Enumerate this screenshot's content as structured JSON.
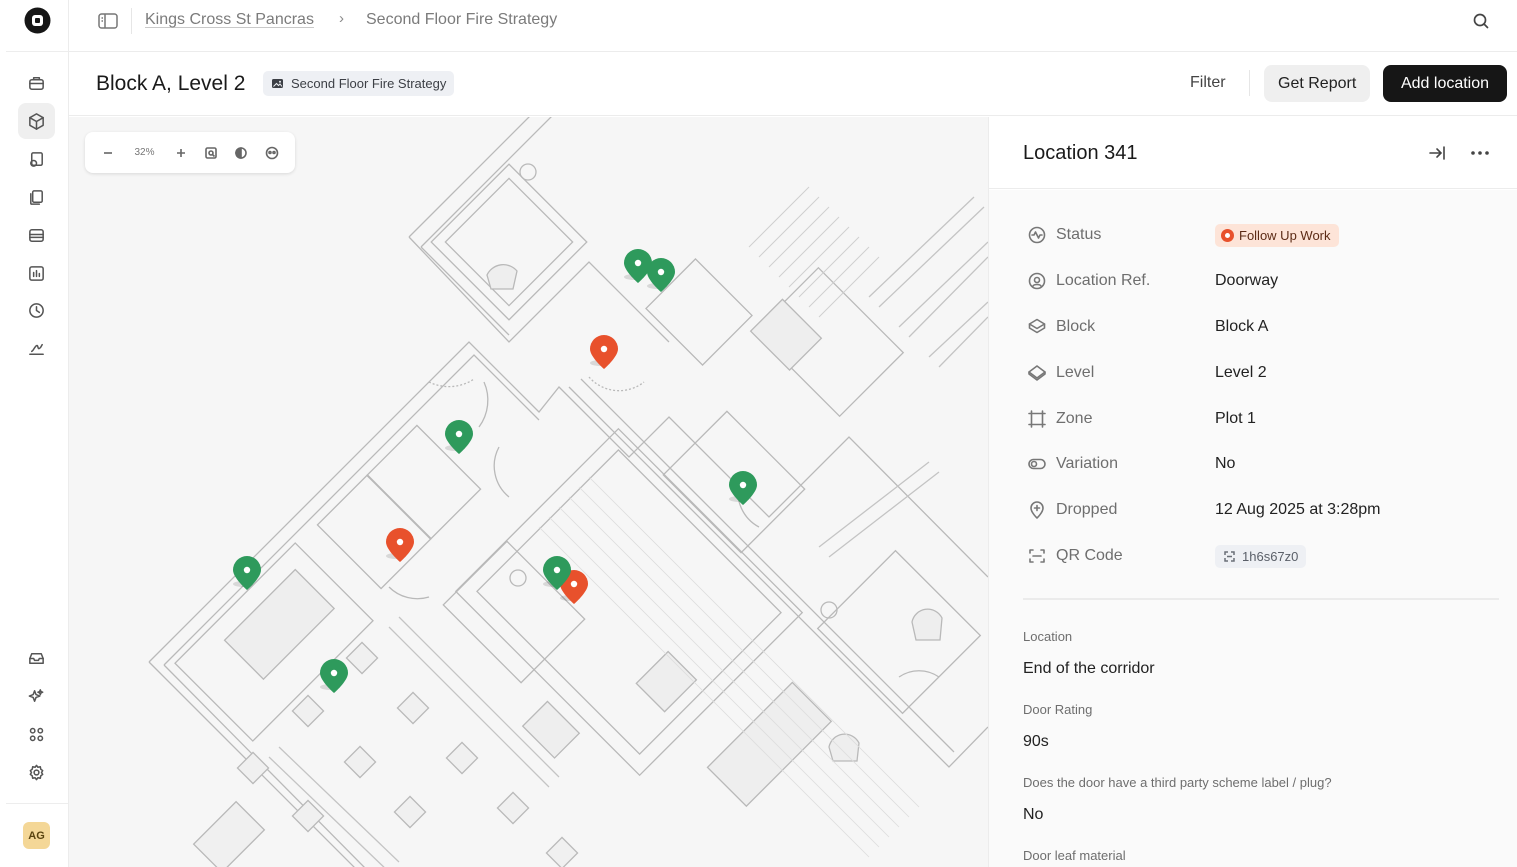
{
  "app": {
    "avatar_initials": "AG",
    "colors": {
      "accent_dark": "#161616",
      "pin_green": "#2e9a5c",
      "pin_orange": "#e8512c"
    }
  },
  "breadcrumb": {
    "project": "Kings Cross St Pancras",
    "separator": "›",
    "plan": "Second Floor Fire Strategy"
  },
  "header": {
    "title": "Block A, Level 2",
    "plan_tag": "Second Floor Fire Strategy",
    "filter_label": "Filter",
    "report_label": "Get Report",
    "add_label": "Add location"
  },
  "map": {
    "zoom_level": "32%",
    "pins": [
      {
        "status": "green"
      },
      {
        "status": "green"
      },
      {
        "status": "orange"
      },
      {
        "status": "green"
      },
      {
        "status": "green"
      },
      {
        "status": "orange"
      },
      {
        "status": "green"
      },
      {
        "status": "orange"
      },
      {
        "status": "green"
      },
      {
        "status": "green"
      }
    ]
  },
  "detail": {
    "title": "Location 341",
    "properties": {
      "status": {
        "label": "Status",
        "value": "Follow Up Work"
      },
      "location_ref": {
        "label": "Location Ref.",
        "value": "Doorway"
      },
      "block": {
        "label": "Block",
        "value": "Block A"
      },
      "level": {
        "label": "Level",
        "value": "Level 2"
      },
      "zone": {
        "label": "Zone",
        "value": "Plot 1"
      },
      "variation": {
        "label": "Variation",
        "value": "No"
      },
      "dropped": {
        "label": "Dropped",
        "value": "12 Aug 2025 at 3:28pm"
      },
      "qr_code": {
        "label": "QR Code",
        "value": "1h6s67z0"
      }
    },
    "fields": {
      "location": {
        "label": "Location",
        "value": "End of the corridor"
      },
      "door_rating": {
        "label": "Door Rating",
        "value": "90s"
      },
      "third_party": {
        "label": "Does the door have a third party scheme label / plug?",
        "value": "No"
      },
      "door_leaf": {
        "label": "Door leaf material"
      }
    }
  }
}
